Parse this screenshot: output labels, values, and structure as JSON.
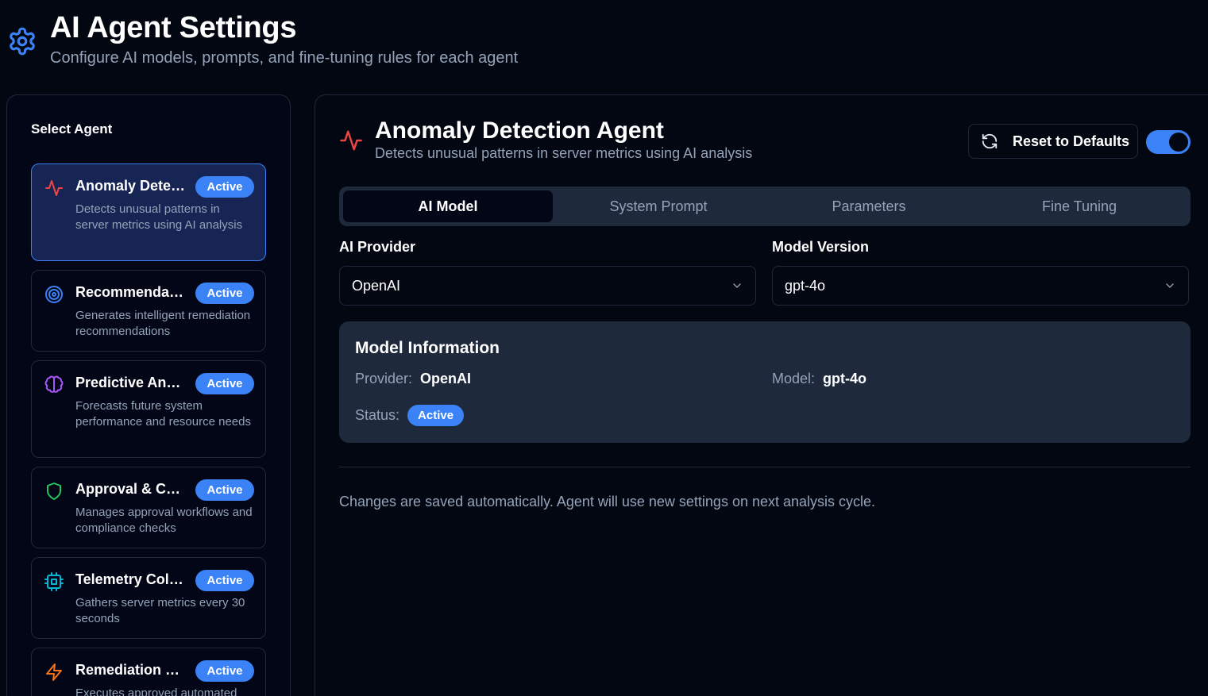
{
  "header": {
    "title": "AI Agent Settings",
    "subtitle": "Configure AI models, prompts, and fine-tuning rules for each agent",
    "icon": "gear-icon"
  },
  "sidebar": {
    "title": "Select Agent",
    "agents": [
      {
        "name": "Anomaly Detection Agent",
        "badge": "Active",
        "description": "Detects unusual patterns in server metrics using AI analysis",
        "icon": "activity-icon",
        "color": "#ef4444",
        "selected": true
      },
      {
        "name": "Recommendation Agent",
        "badge": "Active",
        "description": "Generates intelligent remediation recommendations",
        "icon": "target-icon",
        "color": "#3b82f6"
      },
      {
        "name": "Predictive Analytics Agent",
        "badge": "Active",
        "description": "Forecasts future system performance and resource needs",
        "icon": "brain-icon",
        "color": "#a855f7"
      },
      {
        "name": "Approval & Compliance Agent",
        "badge": "Active",
        "description": "Manages approval workflows and compliance checks",
        "icon": "shield-icon",
        "color": "#22c55e"
      },
      {
        "name": "Telemetry Collector Agent",
        "badge": "Active",
        "description": "Gathers server metrics every 30 seconds",
        "icon": "cpu-icon",
        "color": "#06b6d4"
      },
      {
        "name": "Remediation Executor Agent",
        "badge": "Active",
        "description": "Executes approved automated",
        "icon": "zap-icon",
        "color": "#f97316"
      }
    ]
  },
  "main": {
    "title": "Anomaly Detection Agent",
    "subtitle": "Detects unusual patterns in server metrics using AI analysis",
    "reset_label": "Reset to Defaults",
    "enabled": true,
    "tabs": [
      {
        "label": "AI Model",
        "active": true
      },
      {
        "label": "System Prompt"
      },
      {
        "label": "Parameters"
      },
      {
        "label": "Fine Tuning"
      }
    ],
    "provider": {
      "label": "AI Provider",
      "value": "OpenAI"
    },
    "model_version": {
      "label": "Model Version",
      "value": "gpt-4o"
    },
    "info": {
      "title": "Model Information",
      "provider_key": "Provider:",
      "provider_value": "OpenAI",
      "model_key": "Model:",
      "model_value": "gpt-4o",
      "status_key": "Status:",
      "status_value": "Active"
    },
    "footer_note": "Changes are saved automatically. Agent will use new settings on next analysis cycle."
  },
  "colors": {
    "background": "#030712",
    "accent": "#3b82f6",
    "card": "#1e293b",
    "muted_text": "#94a3b8"
  }
}
